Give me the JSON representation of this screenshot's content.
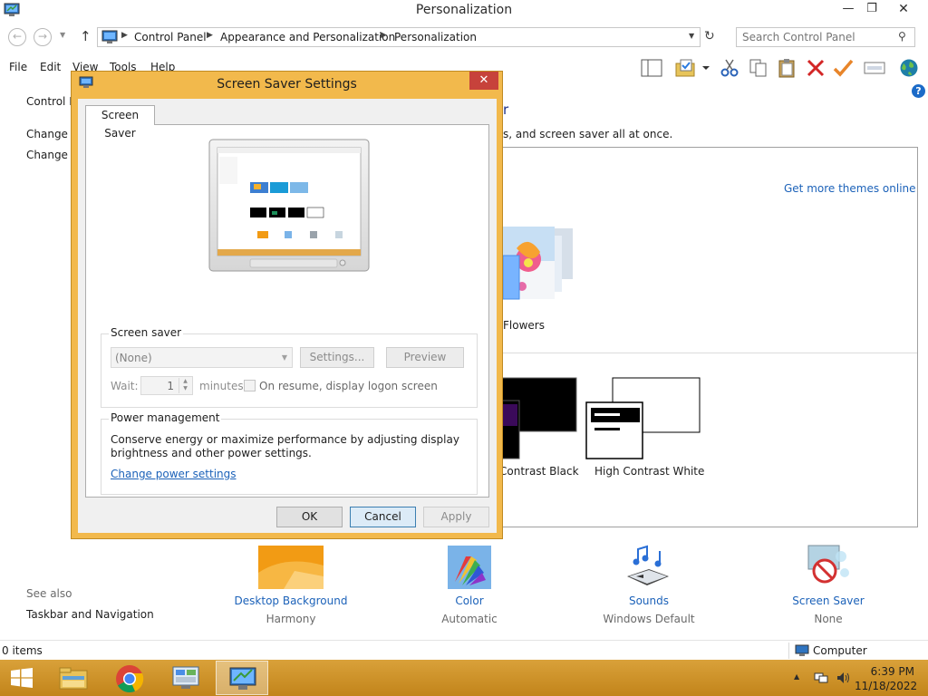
{
  "window": {
    "title": "Personalization",
    "minimize": "—",
    "maximize": "❐",
    "close": "✕"
  },
  "nav": {
    "back": "←",
    "forward": "→",
    "up": "↑",
    "breadcrumb": [
      "Control Panel",
      "Appearance and Personalization",
      "Personalization"
    ],
    "refresh": "↻",
    "search_placeholder": "Search Control Panel"
  },
  "menu": [
    "File",
    "Edit",
    "View",
    "Tools",
    "Help"
  ],
  "left_pane": {
    "home": "Control P",
    "change_1": "Change c",
    "change_2": "Change m",
    "see_also": "See also",
    "taskbar_nav": "Taskbar and Navigation"
  },
  "content": {
    "heading_tail": "r",
    "subtext_tail": "s, and screen saver all at once.",
    "get_more": "Get more themes online",
    "themes": {
      "flowers": "Flowers",
      "contrast_black_tail": "Contrast Black",
      "high_contrast_white": "High Contrast White"
    },
    "tiles": [
      {
        "label": "Desktop Background",
        "sub": "Harmony"
      },
      {
        "label": "Color",
        "sub": "Automatic"
      },
      {
        "label": "Sounds",
        "sub": "Windows Default"
      },
      {
        "label": "Screen Saver",
        "sub": "None"
      }
    ]
  },
  "status": {
    "items": "0 items",
    "location": "Computer"
  },
  "taskbar": {
    "time": "6:39 PM",
    "date": "11/18/2022"
  },
  "dialog": {
    "title": "Screen Saver Settings",
    "close": "✕",
    "tab": "Screen Saver",
    "screen_saver_group": "Screen saver",
    "selected": "(None)",
    "settings_btn": "Settings...",
    "preview_btn": "Preview",
    "wait_label": "Wait:",
    "wait_value": "1",
    "minutes": "minutes",
    "resume_label": "On resume, display logon screen",
    "power_group": "Power management",
    "power_text": "Conserve energy or maximize performance by adjusting display brightness and other power settings.",
    "power_link": "Change power settings",
    "ok": "OK",
    "cancel": "Cancel",
    "apply": "Apply"
  }
}
